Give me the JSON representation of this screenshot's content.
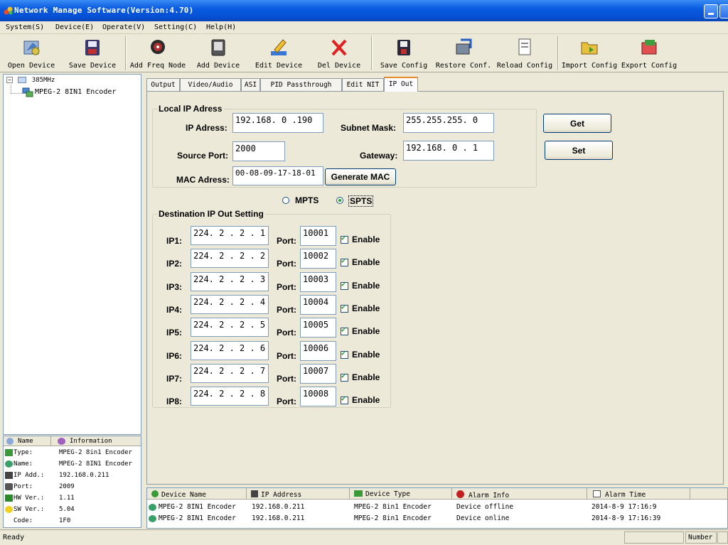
{
  "window": {
    "title": "Network Manage Software(Version:4.70)"
  },
  "menu": [
    "System(S)",
    "Device(E)",
    "Operate(V)",
    "Setting(C)",
    "Help(H)"
  ],
  "toolbar": [
    {
      "label": "Open Device",
      "icon": "open-device-icon"
    },
    {
      "label": "Save Device",
      "icon": "save-device-icon"
    },
    {
      "label": "Add Freq Node",
      "icon": "add-freq-node-icon"
    },
    {
      "label": "Add Device",
      "icon": "add-device-icon"
    },
    {
      "label": "Edit Device",
      "icon": "edit-device-icon"
    },
    {
      "label": "Del Device",
      "icon": "del-device-icon"
    },
    {
      "label": "Save Config",
      "icon": "save-config-icon"
    },
    {
      "label": "Restore Conf.",
      "icon": "restore-conf-icon"
    },
    {
      "label": "Reload Config",
      "icon": "reload-config-icon"
    },
    {
      "label": "Import Config",
      "icon": "import-config-icon"
    },
    {
      "label": "Export Config",
      "icon": "export-config-icon"
    }
  ],
  "tree": {
    "root": "385MHz",
    "child": "MPEG-2 8IN1 Encoder"
  },
  "info": {
    "headers": [
      "Name",
      "Information"
    ],
    "rows": [
      {
        "key": "Type:",
        "value": "MPEG-2 8in1 Encoder"
      },
      {
        "key": "Name:",
        "value": "MPEG-2 8IN1 Encoder"
      },
      {
        "key": "IP Add.:",
        "value": "192.168.0.211"
      },
      {
        "key": "Port:",
        "value": "2009"
      },
      {
        "key": "HW Ver.:",
        "value": "1.11"
      },
      {
        "key": "SW Ver.:",
        "value": "5.04"
      },
      {
        "key": "Code:",
        "value": "1F0"
      }
    ]
  },
  "tabs": [
    "Output",
    "Video/Audio",
    "ASI",
    "PID Passthrough",
    "Edit NIT",
    "IP Out"
  ],
  "active_tab": "IP Out",
  "local_ip": {
    "title": "Local IP Adress",
    "ip_label": "IP Adress:",
    "ip_value": "192.168. 0 .190",
    "mask_label": "Subnet Mask:",
    "mask_value": "255.255.255. 0",
    "source_port_label": "Source Port:",
    "source_port_value": "2000",
    "gateway_label": "Gateway:",
    "gateway_value": "192.168. 0 . 1",
    "mac_label": "MAC Adress:",
    "mac_value": "00-08-09-17-18-01",
    "generate_mac": "Generate MAC"
  },
  "buttons": {
    "get": "Get",
    "set": "Set"
  },
  "mode": {
    "mpts": "MPTS",
    "spts": "SPTS",
    "selected": "SPTS"
  },
  "dest": {
    "title": "Destination IP Out Setting",
    "port_label": "Port:",
    "enable_label": "Enable",
    "rows": [
      {
        "label": "IP1:",
        "ip": "224. 2 . 2 . 1",
        "port": "10001",
        "enabled": true
      },
      {
        "label": "IP2:",
        "ip": "224. 2 . 2 . 2",
        "port": "10002",
        "enabled": true
      },
      {
        "label": "IP3:",
        "ip": "224. 2 . 2 . 3",
        "port": "10003",
        "enabled": true
      },
      {
        "label": "IP4:",
        "ip": "224. 2 . 2 . 4",
        "port": "10004",
        "enabled": true
      },
      {
        "label": "IP5:",
        "ip": "224. 2 . 2 . 5",
        "port": "10005",
        "enabled": true
      },
      {
        "label": "IP6:",
        "ip": "224. 2 . 2 . 6",
        "port": "10006",
        "enabled": true
      },
      {
        "label": "IP7:",
        "ip": "224. 2 . 2 . 7",
        "port": "10007",
        "enabled": true
      },
      {
        "label": "IP8:",
        "ip": "224. 2 . 2 . 8",
        "port": "10008",
        "enabled": true
      }
    ]
  },
  "alarm": {
    "headers": [
      "Device Name",
      "IP Address",
      "Device Type",
      "Alarm Info",
      "Alarm Time"
    ],
    "rows": [
      {
        "name": "MPEG-2 8IN1 Encoder",
        "ip": "192.168.0.211",
        "type": "MPEG-2 8in1 Encoder",
        "info": "Device offline",
        "time": "2014-8-9 17:16:9"
      },
      {
        "name": "MPEG-2 8IN1 Encoder",
        "ip": "192.168.0.211",
        "type": "MPEG-2 8in1 Encoder",
        "info": "Device online",
        "time": "2014-8-9 17:16:39"
      }
    ]
  },
  "status": {
    "text": "Ready",
    "number": "Number"
  }
}
